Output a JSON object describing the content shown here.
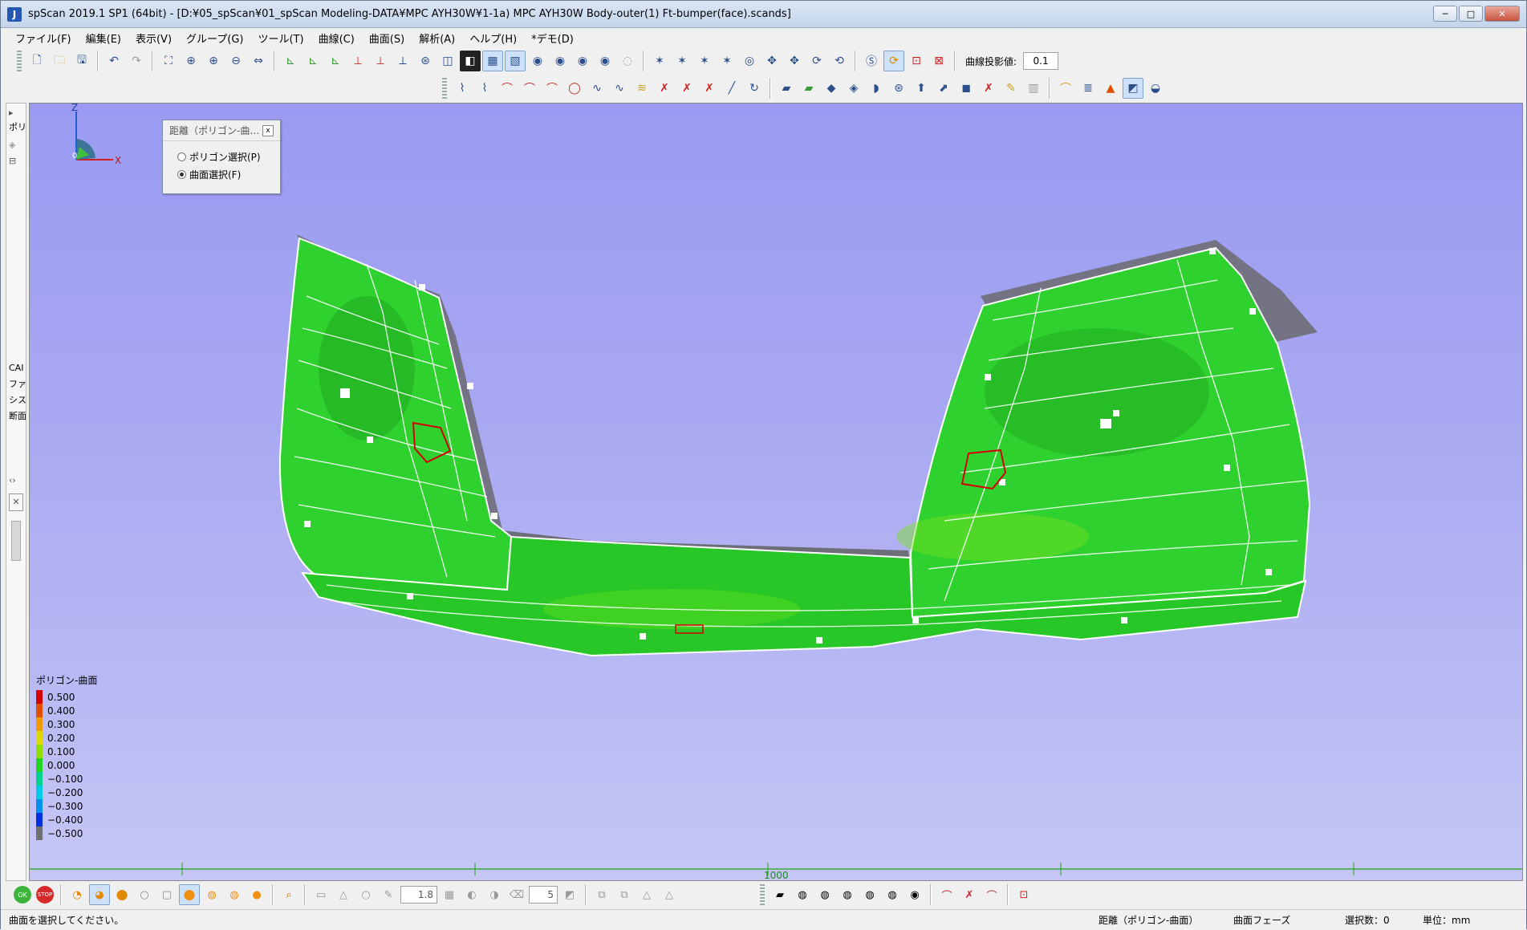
{
  "window": {
    "app_icon": "J",
    "title": "spScan 2019.1 SP1 (64bit) - [D:¥05_spScan¥01_spScan Modeling-DATA¥MPC AYH30W¥1-1a) MPC AYH30W Body-outer(1) Ft-bumper(face).scands]",
    "minimize": "─",
    "maximize": "□",
    "close": "✕"
  },
  "menu": {
    "items": [
      "ファイル(F)",
      "編集(E)",
      "表示(V)",
      "グループ(G)",
      "ツール(T)",
      "曲線(C)",
      "曲面(S)",
      "解析(A)",
      "ヘルプ(H)",
      "*デモ(D)"
    ]
  },
  "toolbar": {
    "projection_label": "曲線投影値:",
    "projection_value": "0.1"
  },
  "left_panel": {
    "texts": [
      "ポリ",
      "CAI",
      "ファ",
      "シス",
      "断面"
    ]
  },
  "viewport": {
    "axis_z": "Z",
    "axis_x": "X",
    "axis_origin": "0",
    "ruler_label": "1000"
  },
  "dialog": {
    "title": "距離（ポリゴン-曲…",
    "close": "x",
    "options": [
      {
        "label": "ポリゴン選択(P)",
        "checked": false
      },
      {
        "label": "曲面選択(F)",
        "checked": true
      }
    ]
  },
  "legend": {
    "title": "ポリゴン-曲面",
    "entries": [
      {
        "label": "0.500",
        "color": "#d40000"
      },
      {
        "label": "0.400",
        "color": "#e05000"
      },
      {
        "label": "0.300",
        "color": "#ee9a00"
      },
      {
        "label": "0.200",
        "color": "#dcd800"
      },
      {
        "label": "0.100",
        "color": "#8fe000"
      },
      {
        "label": "0.000",
        "color": "#22d422"
      },
      {
        "label": "−0.100",
        "color": "#00d490"
      },
      {
        "label": "−0.200",
        "color": "#00cce6"
      },
      {
        "label": "−0.300",
        "color": "#0090f0"
      },
      {
        "label": "−0.400",
        "color": "#0030e0"
      },
      {
        "label": "−0.500",
        "color": "#707070"
      }
    ]
  },
  "bottom_toolbar": {
    "ok": "OK",
    "stop": "STOP",
    "line_width": "1.8",
    "count": "5"
  },
  "status": {
    "message": "曲面を選択してください。",
    "mode": "距離（ポリゴン-曲面）",
    "phase": "曲面フェーズ",
    "selection": "選択数：0",
    "unit": "単位：mm"
  },
  "colors": {
    "viewport_bg": "#a8a8f2",
    "surface": "#2fd12f",
    "surface_dark": "#1faa1f",
    "edge_gray": "#6e6e78",
    "hole_red": "#d40000"
  }
}
